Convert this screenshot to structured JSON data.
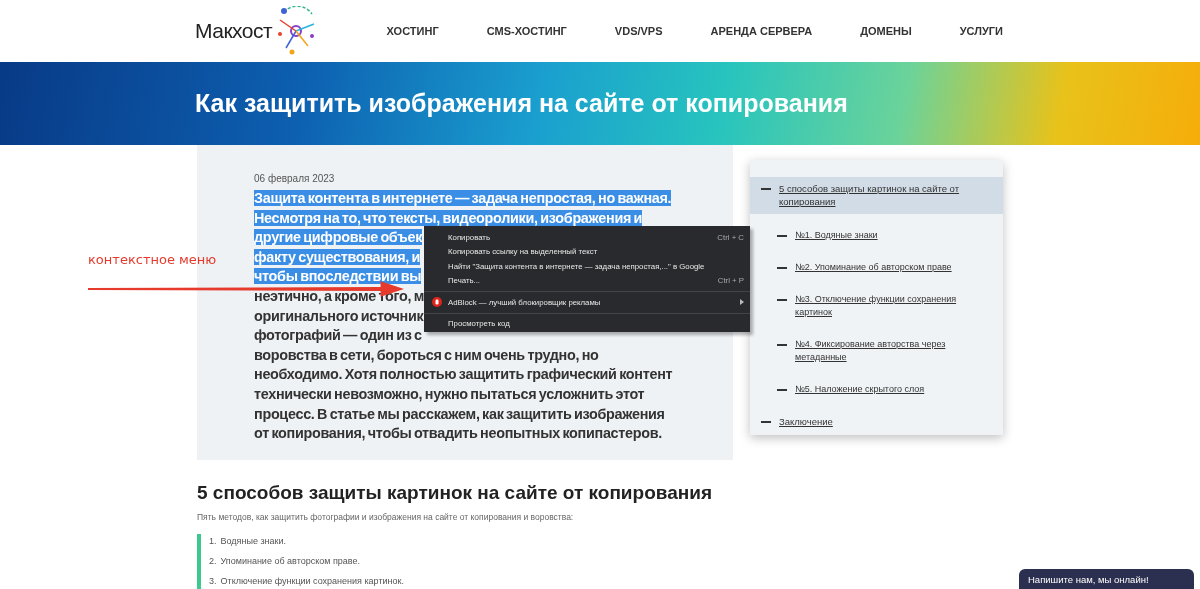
{
  "header": {
    "logo": "Макхост",
    "nav": [
      {
        "label": "ХОСТИНГ",
        "selected": false
      },
      {
        "label": "CMS-ХОСТИНГ",
        "selected": false
      },
      {
        "label": "VDS/VPS",
        "selected": false
      },
      {
        "label": "АРЕНДА СЕРВЕРА",
        "selected": false
      },
      {
        "label": "ДОМЕНЫ",
        "selected": false
      },
      {
        "label": "УСЛУГИ",
        "selected": false
      }
    ]
  },
  "banner": {
    "title": "Как защитить изображения на сайте от копирования"
  },
  "article": {
    "date": "06 февраля 2023",
    "lines": [
      {
        "text": "Защита контента в интернете — задача непростая, но важная.",
        "selected": true
      },
      {
        "text": "Несмотря на то, что тексты, видеоролики, изображения и",
        "selected": true
      },
      {
        "text": "другие цифровые объек",
        "selected": true
      },
      {
        "text": "факту существования, и",
        "selected": true
      },
      {
        "text": "чтобы впоследствии вы",
        "selected": true
      },
      {
        "text": "неэтично, а кроме того, м",
        "selected": false
      },
      {
        "text": "оригинального источник",
        "selected": false
      },
      {
        "text": "фотографий — один из с",
        "selected": false
      },
      {
        "text": "воровства в сети, бороться с ним очень трудно, но",
        "selected": false
      },
      {
        "text": "необходимо. Хотя полностью защитить графический контент",
        "selected": false
      },
      {
        "text": "технически невозможно, нужно пытаться усложнить этот",
        "selected": false
      },
      {
        "text": "процесс. В статье мы расскажем, как защитить изображения",
        "selected": false
      },
      {
        "text": "от копирования, чтобы отвадить неопытных копипастеров.",
        "selected": false
      }
    ]
  },
  "annotation": {
    "label": "контекстное меню"
  },
  "context_menu": {
    "items": [
      {
        "kind": "item",
        "label": "Копировать",
        "shortcut": "Ctrl + C"
      },
      {
        "kind": "item",
        "label": "Копировать ссылку на выделенный текст"
      },
      {
        "kind": "item",
        "label": "Найти \"Защита контента в интернете — задача непростая,...\" в Google"
      },
      {
        "kind": "item",
        "label": "Печать...",
        "shortcut": "Ctrl + P"
      },
      {
        "kind": "separator"
      },
      {
        "kind": "extension",
        "label": "AdBlock — лучший блокировщик рекламы"
      },
      {
        "kind": "separator"
      },
      {
        "kind": "item",
        "label": "Просмотреть код"
      }
    ]
  },
  "toc": {
    "items": [
      {
        "label": "5 способов защиты картинок на сайте от копирования",
        "selected": true,
        "children": [
          {
            "label": "№1. Водяные знаки",
            "selected": false
          },
          {
            "label": "№2. Упоминание об авторском праве",
            "selected": false
          },
          {
            "label": "№3. Отключение функции сохранения картинок",
            "selected": false
          },
          {
            "label": "№4. Фиксирование авторства через метаданные",
            "selected": false
          },
          {
            "label": "№5. Наложение скрытого слоя",
            "selected": false
          }
        ]
      },
      {
        "label": "Заключение",
        "selected": false
      }
    ]
  },
  "section": {
    "heading": "5 способов защиты картинок на сайте от копирования",
    "intro": "Пять методов, как защитить фотографии и изображения на сайте от копирования и воровства:",
    "list": [
      {
        "number": "1.",
        "text": "Водяные знаки."
      },
      {
        "number": "2.",
        "text": "Упоминание об авторском праве."
      },
      {
        "number": "3.",
        "text": "Отключение функции сохранения картинок."
      }
    ]
  },
  "chat": {
    "label": "Напишите нам, мы онлайн!"
  }
}
